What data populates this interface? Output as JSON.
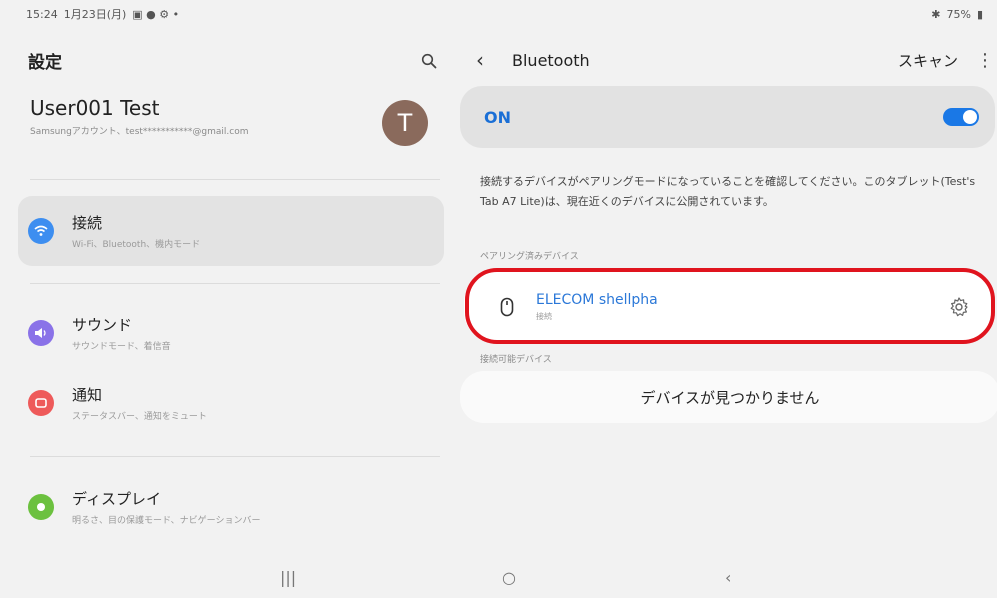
{
  "status_bar": {
    "time": "15:24",
    "date": "1月23日(月)",
    "right": "75%"
  },
  "left": {
    "title": "設定",
    "search_icon": "search-icon",
    "account": {
      "name": "User001 Test",
      "sub": "Samsungアカウント、test***********@gmail.com",
      "avatar_letter": "T"
    },
    "items": [
      {
        "title": "接続",
        "sub": "Wi-Fi、Bluetooth、機内モード",
        "icon": "wifi-icon",
        "color": "#3d8ef0"
      },
      {
        "title": "サウンド",
        "sub": "サウンドモード、着信音",
        "icon": "sound-icon",
        "color": "#8a72e8"
      },
      {
        "title": "通知",
        "sub": "ステータスバー、通知をミュート",
        "icon": "notification-icon",
        "color": "#ee5a5a"
      },
      {
        "title": "ディスプレイ",
        "sub": "明るさ、目の保護モード、ナビゲーションバー",
        "icon": "display-icon",
        "color": "#6cc13f"
      }
    ]
  },
  "right": {
    "title": "Bluetooth",
    "scan_label": "スキャン",
    "toggle_label": "ON",
    "toggle_on": true,
    "description": "接続するデバイスがペアリングモードになっていることを確認してください。このタブレット(Test's Tab A7 Lite)は、現在近くのデバイスに公開されています。",
    "paired_label": "ペアリング済みデバイス",
    "paired_device": {
      "name": "ELECOM shellpha",
      "status": "接続"
    },
    "available_label": "接続可能デバイス",
    "no_devices": "デバイスが見つかりません"
  },
  "colors": {
    "accent": "#1a78e6",
    "highlight": "#e0141e"
  }
}
